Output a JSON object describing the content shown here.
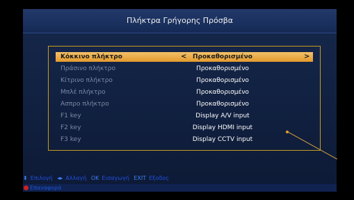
{
  "title": "Πλήκτρα Γρήγορης Πρόσβα",
  "rows": [
    {
      "label": "Κόκκινο πλήκτρο",
      "value": "Προκαθορισμένο"
    },
    {
      "label": "Πράσινο πλήκτρο",
      "value": "Προκαθορισμένο"
    },
    {
      "label": "Κίτρινο πλήκτρο",
      "value": "Προκαθορισμένο"
    },
    {
      "label": "Μπλέ πλήκτρο",
      "value": "Προκαθορισμένο"
    },
    {
      "label": "Ασπρο πλήκτρο",
      "value": "Προκαθορισμένο"
    },
    {
      "label": "F1 key",
      "value": "Display A/V input"
    },
    {
      "label": "F2 key",
      "value": "Display HDMI input"
    },
    {
      "label": "F3 key",
      "value": "Display CCTV input"
    }
  ],
  "arrows": {
    "left": "<",
    "right": ">"
  },
  "footer": {
    "select": "Επιλογή",
    "change": "Αλλαγή",
    "ok_key": "OK",
    "enter": "Εισαγωγή",
    "exit_key": "EXIT",
    "exit": "Εξοδος"
  },
  "bottom": {
    "reset": "Επαναφορά"
  },
  "colors": {
    "selected_row": "#f2c16a",
    "panel_border": "#c99c1e",
    "background": "#16284c"
  }
}
